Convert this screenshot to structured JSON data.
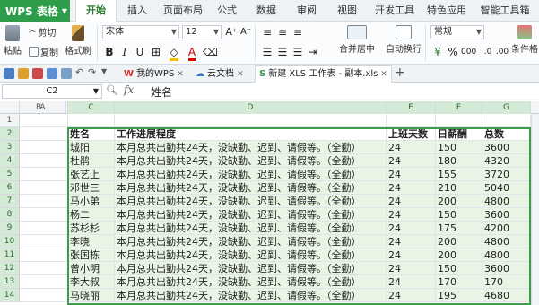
{
  "app": {
    "name": "WPS 表格"
  },
  "menu_tabs": [
    "开始",
    "插入",
    "页面布局",
    "公式",
    "数据",
    "审阅",
    "视图",
    "开发工具",
    "特色应用",
    "智能工具箱"
  ],
  "ribbon": {
    "cut": "剪切",
    "paste": "粘贴",
    "copy": "复制",
    "format_painter": "格式刷",
    "font_name": "宋体",
    "font_size": "12",
    "merge_center": "合并居中",
    "wrap_text": "自动换行",
    "number_format": "常规",
    "conditional_format": "条件格"
  },
  "doc_tabs": [
    {
      "label": "我的WPS"
    },
    {
      "label": "云文档"
    },
    {
      "label": "新建 XLS 工作表 - 副本.xls"
    }
  ],
  "formula_bar": {
    "cell_ref": "C2",
    "fx": "fx",
    "content": "姓名"
  },
  "columns": [
    "A",
    "B",
    "C",
    "D",
    "E",
    "F",
    "G"
  ],
  "rows": [
    "1",
    "2",
    "3",
    "4",
    "5",
    "6",
    "7",
    "8",
    "9",
    "10",
    "11",
    "12",
    "13",
    "14"
  ],
  "table": {
    "headers": [
      "姓名",
      "工作进展程度",
      "上班天数",
      "日薪酬",
      "总数"
    ],
    "rows": [
      [
        "城阳",
        "本月总共出勤共24天，没缺勤、迟到、请假等。（全勤）",
        "24",
        "150",
        "3600"
      ],
      [
        "杜鹃",
        "本月总共出勤共24天，没缺勤、迟到、请假等。（全勤）",
        "24",
        "180",
        "4320"
      ],
      [
        "张艺上",
        "本月总共出勤共24天，没缺勤、迟到、请假等。（全勤）",
        "24",
        "155",
        "3720"
      ],
      [
        "邓世三",
        "本月总共出勤共24天，没缺勤、迟到、请假等。（全勤）",
        "24",
        "210",
        "5040"
      ],
      [
        "马小弟",
        "本月总共出勤共24天，没缺勤、迟到、请假等。（全勤）",
        "24",
        "200",
        "4800"
      ],
      [
        "杨二",
        "本月总共出勤共24天，没缺勤、迟到、请假等。（全勤）",
        "24",
        "150",
        "3600"
      ],
      [
        "苏杉杉",
        "本月总共出勤共24天，没缺勤、迟到、请假等。（全勤）",
        "24",
        "175",
        "4200"
      ],
      [
        "李晓",
        "本月总共出勤共24天，没缺勤、迟到、请假等。（全勤）",
        "24",
        "200",
        "4800"
      ],
      [
        "张国栋",
        "本月总共出勤共24天，没缺勤、迟到、请假等。（全勤）",
        "24",
        "200",
        "4800"
      ],
      [
        "曾小明",
        "本月总共出勤共24天，没缺勤、迟到、请假等。（全勤）",
        "24",
        "150",
        "3600"
      ],
      [
        "李大叔",
        "本月总共出勤共24天，没缺勤、迟到、请假等。（全勤）",
        "24",
        "170",
        "170"
      ],
      [
        "马晓丽",
        "本月总共出勤共24天，没缺勤、迟到、请假等。（全勤）",
        "24",
        "195",
        "4680"
      ]
    ]
  },
  "colors": {
    "brand": "#2e9d4a",
    "selection_fill": "#e8f5e4",
    "selection_border": "#3f9a4a"
  }
}
